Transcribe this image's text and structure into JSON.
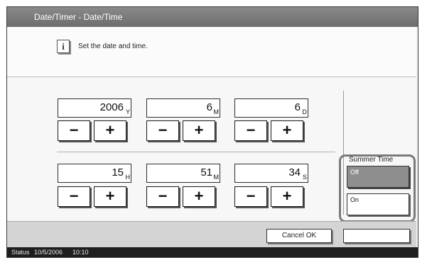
{
  "title": "Date/Timer - Date/Time",
  "message": {
    "icon": "info-icon",
    "text": "Set the date and time."
  },
  "date": {
    "year": {
      "value": "2006",
      "unit": "Y"
    },
    "month": {
      "value": "6",
      "unit": "M"
    },
    "day": {
      "value": "6",
      "unit": "D"
    }
  },
  "time": {
    "hour": {
      "value": "15",
      "unit": "H"
    },
    "minute": {
      "value": "51",
      "unit": "M"
    },
    "second": {
      "value": "34",
      "unit": "S"
    }
  },
  "stepper": {
    "minus": "−",
    "plus": "+"
  },
  "summer_time": {
    "label": "Summer Time",
    "options": [
      "Off",
      "On"
    ],
    "selected": "Off"
  },
  "footer": {
    "cancel_ok_label": "Cancel OK"
  },
  "status": {
    "label": "Status",
    "date": "10/5/2006",
    "time": "10:10"
  }
}
